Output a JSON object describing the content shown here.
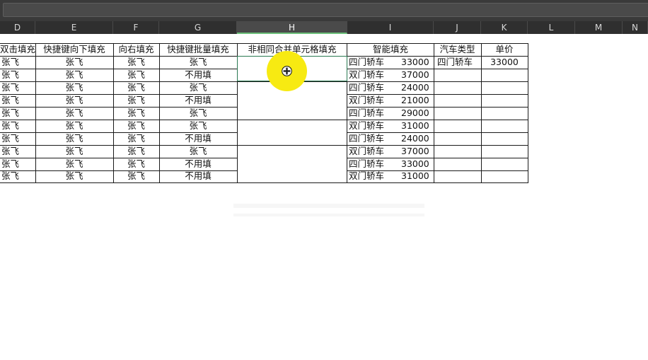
{
  "colors": {
    "header_bg": "#2f2f2f",
    "grid": "#1a1a1a",
    "highlight": "#f7ea12",
    "active_border": "#2a7a52"
  },
  "columns": [
    "D",
    "E",
    "F",
    "G",
    "H",
    "I",
    "J",
    "K",
    "L",
    "M",
    "N"
  ],
  "headers": {
    "D": "双击填充",
    "E": "快捷键向下填充",
    "F": "向右填充",
    "G": "快捷键批量填充",
    "H": "非相同合并单元格填充",
    "I": "智能填充",
    "J": "汽车类型",
    "K": "单价"
  },
  "rows": [
    {
      "D": "张飞",
      "E": "张飞",
      "F": "张飞",
      "G": "张飞",
      "I_type": "四门轿车",
      "I_price": "33000",
      "J": "四门轿车",
      "K": "33000"
    },
    {
      "D": "张飞",
      "E": "张飞",
      "F": "张飞",
      "G": "不用填",
      "I_type": "双门轿车",
      "I_price": "37000",
      "J": "",
      "K": ""
    },
    {
      "D": "张飞",
      "E": "张飞",
      "F": "张飞",
      "G": "张飞",
      "I_type": "四门轿车",
      "I_price": "24000",
      "J": "",
      "K": ""
    },
    {
      "D": "张飞",
      "E": "张飞",
      "F": "张飞",
      "G": "不用填",
      "I_type": "双门轿车",
      "I_price": "21000",
      "J": "",
      "K": ""
    },
    {
      "D": "张飞",
      "E": "张飞",
      "F": "张飞",
      "G": "张飞",
      "I_type": "四门轿车",
      "I_price": "29000",
      "J": "",
      "K": ""
    },
    {
      "D": "张飞",
      "E": "张飞",
      "F": "张飞",
      "G": "张飞",
      "I_type": "双门轿车",
      "I_price": "31000",
      "J": "",
      "K": ""
    },
    {
      "D": "张飞",
      "E": "张飞",
      "F": "张飞",
      "G": "不用填",
      "I_type": "四门轿车",
      "I_price": "24000",
      "J": "",
      "K": ""
    },
    {
      "D": "张飞",
      "E": "张飞",
      "F": "张飞",
      "G": "张飞",
      "I_type": "双门轿车",
      "I_price": "37000",
      "J": "",
      "K": ""
    },
    {
      "D": "张飞",
      "E": "张飞",
      "F": "张飞",
      "G": "不用填",
      "I_type": "四门轿车",
      "I_price": "33000",
      "J": "",
      "K": ""
    },
    {
      "D": "张飞",
      "E": "张飞",
      "F": "张飞",
      "G": "不用填",
      "I_type": "双门轿车",
      "I_price": "31000",
      "J": "",
      "K": ""
    }
  ],
  "cursor": {
    "icon": "move-cross-icon"
  }
}
